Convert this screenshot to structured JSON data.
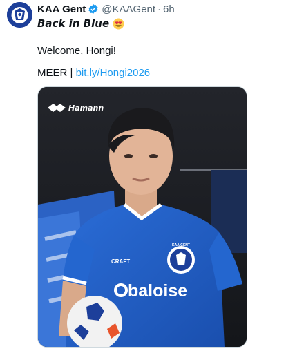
{
  "tweet": {
    "author_name": "KAA Gent",
    "handle": "@KAAGent",
    "separator": "·",
    "time": "6h",
    "line1": "Back in Blue",
    "emoji_icon": "heart-eyes-emoji",
    "line2": "Welcome, Hongi!",
    "line3_prefix": "MEER | ",
    "link_text": "bit.ly/Hongi2026"
  },
  "photo": {
    "sponsor_logo": "Hamann",
    "shirt_brand": "CRAFT",
    "shirt_sponsor": "baloise",
    "crest_text": "KAA GENT"
  },
  "colors": {
    "link": "#1d9bf0",
    "verified": "#1d9bf0",
    "shirt_blue": "#1f5fc8",
    "muted": "#536471"
  }
}
